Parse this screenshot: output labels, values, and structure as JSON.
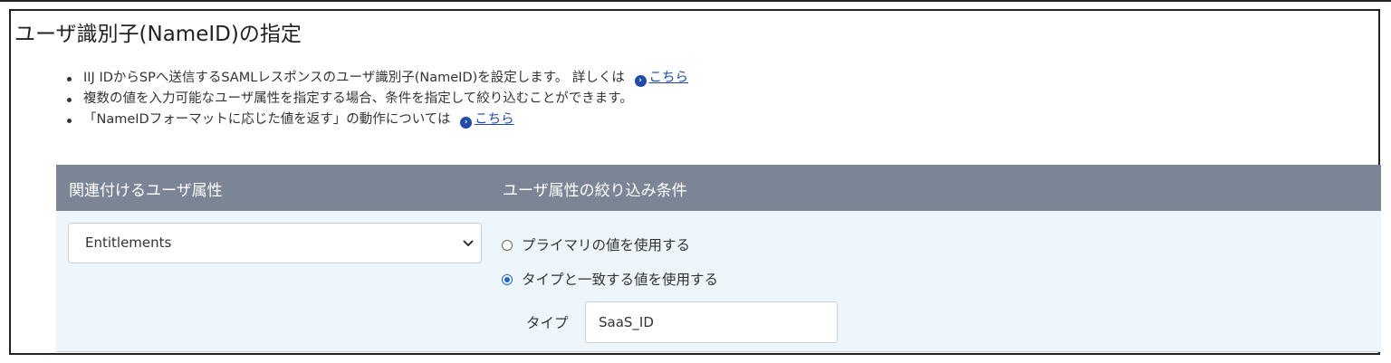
{
  "title": "ユーザ識別子(NameID)の指定",
  "notes": [
    {
      "text": "IIJ IDからSPへ送信するSAMLレスポンスのユーザ識別子(NameID)を設定します。 詳しくは",
      "link": "こちら"
    },
    {
      "text": "複数の値を入力可能なユーザ属性を指定する場合、条件を指定して絞り込むことができます。",
      "link": ""
    },
    {
      "text": "「NameIDフォーマットに応じた値を返す」の動作については",
      "link": "こちら"
    }
  ],
  "table": {
    "headers": [
      "関連付けるユーザ属性",
      "ユーザ属性の絞り込み条件"
    ],
    "attribute_select": {
      "value": "Entitlements"
    },
    "radios": [
      {
        "label": "プライマリの値を使用する",
        "checked": false
      },
      {
        "label": "タイプと一致する値を使用する",
        "checked": true
      }
    ],
    "type_field": {
      "label": "タイプ",
      "value": "SaaS_ID"
    }
  },
  "colors": {
    "header_bg": "#7b8596",
    "row_bg": "#eef5fb",
    "link": "#1f4aa8",
    "radio_accent": "#1a66d9"
  },
  "icons": {
    "link_icon": "circle-chevron-right-icon",
    "select_icon": "chevron-down-icon"
  }
}
